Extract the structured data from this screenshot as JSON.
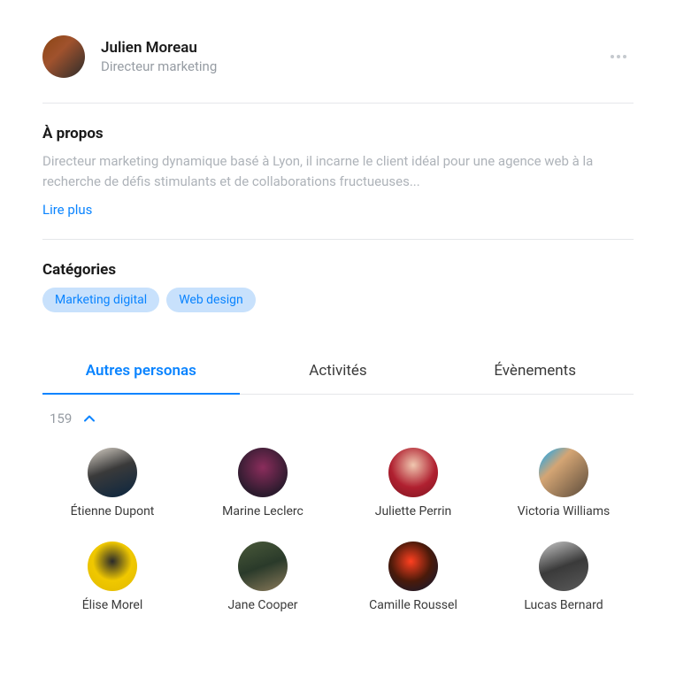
{
  "header": {
    "name": "Julien Moreau",
    "title": "Directeur marketing"
  },
  "about": {
    "heading": "À propos",
    "text": "Directeur marketing dynamique basé à Lyon, il incarne le client idéal pour une agence web à la recherche de défis stimulants et de collaborations fructueuses...",
    "readMore": "Lire plus"
  },
  "categories": {
    "heading": "Catégories",
    "tags": [
      "Marketing digital",
      "Web design"
    ]
  },
  "tabs": {
    "items": [
      {
        "label": "Autres personas",
        "active": true
      },
      {
        "label": "Activités",
        "active": false
      },
      {
        "label": "Évènements",
        "active": false
      }
    ]
  },
  "personas": {
    "count": "159",
    "items": [
      {
        "name": "Étienne Dupont",
        "avatarClass": "av1"
      },
      {
        "name": "Marine Leclerc",
        "avatarClass": "av2"
      },
      {
        "name": "Juliette Perrin",
        "avatarClass": "av3"
      },
      {
        "name": "Victoria Williams",
        "avatarClass": "av4"
      },
      {
        "name": "Élise Morel",
        "avatarClass": "av5"
      },
      {
        "name": "Jane Cooper",
        "avatarClass": "av6"
      },
      {
        "name": "Camille Roussel",
        "avatarClass": "av7"
      },
      {
        "name": "Lucas Bernard",
        "avatarClass": "av8"
      }
    ]
  }
}
